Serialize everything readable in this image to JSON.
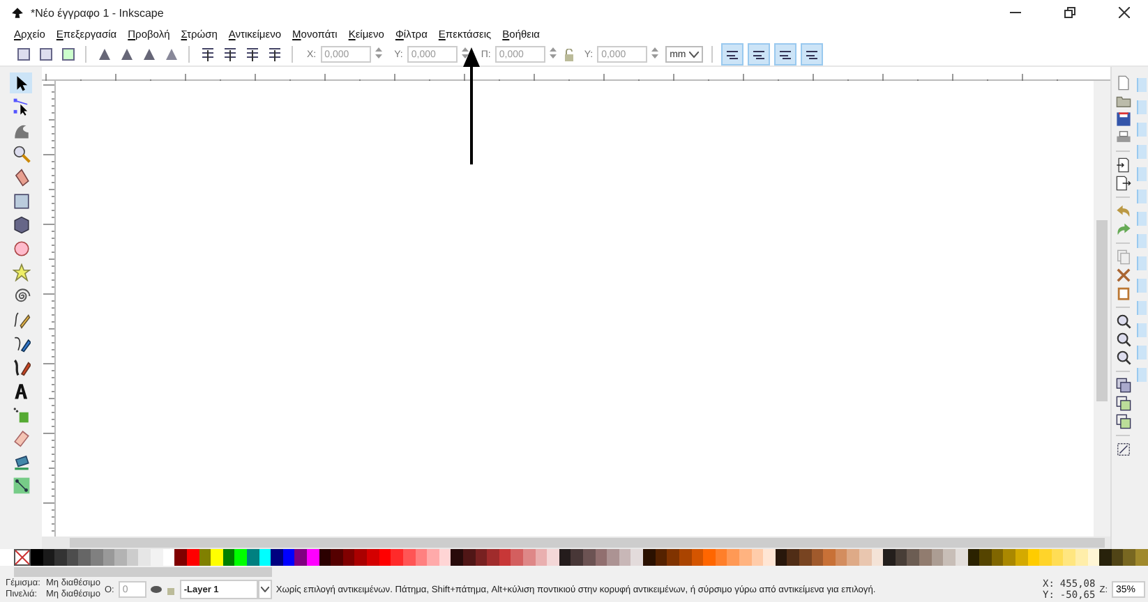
{
  "window": {
    "title": "*Νέο έγγραφο 1 - Inkscape"
  },
  "menu": [
    "Αρχείο",
    "Επεξεργασία",
    "Προβολή",
    "Στρώση",
    "Αντικείμενο",
    "Μονοπάτι",
    "Κείμενο",
    "Φίλτρα",
    "Επεκτάσεις",
    "Βοήθεια"
  ],
  "toolbar": {
    "fields": [
      {
        "label": "X:",
        "value": "0,000"
      },
      {
        "label": "Y:",
        "value": "0,000"
      },
      {
        "label": "Π:",
        "value": "0,000"
      },
      {
        "label": "Υ:",
        "value": "0,000"
      }
    ],
    "unit": "mm",
    "toggles": [
      {
        "on": true
      },
      {
        "on": true
      },
      {
        "on": true
      },
      {
        "on": true
      }
    ]
  },
  "tools": [
    {
      "kind": "selector",
      "selected": true
    },
    {
      "kind": "node",
      "selected": false
    },
    {
      "kind": "tweak",
      "selected": false
    },
    {
      "kind": "zoom",
      "selected": false
    },
    {
      "kind": "measure",
      "selected": false
    },
    {
      "kind": "rect",
      "selected": false
    },
    {
      "kind": "box3d",
      "selected": false
    },
    {
      "kind": "ellipse",
      "selected": false
    },
    {
      "kind": "star",
      "selected": false
    },
    {
      "kind": "spiral",
      "selected": false
    },
    {
      "kind": "pencil",
      "selected": false
    },
    {
      "kind": "pen",
      "selected": false
    },
    {
      "kind": "calligraphy",
      "selected": false
    },
    {
      "kind": "text",
      "selected": false
    },
    {
      "kind": "spray",
      "selected": false
    },
    {
      "kind": "eraser",
      "selected": false
    },
    {
      "kind": "bucket",
      "selected": false
    },
    {
      "kind": "connector",
      "selected": false
    }
  ],
  "commands": [
    {
      "kind": "new"
    },
    {
      "kind": "open"
    },
    {
      "kind": "save"
    },
    {
      "kind": "print"
    },
    {
      "kind": "separator"
    },
    {
      "kind": "import"
    },
    {
      "kind": "export"
    },
    {
      "kind": "separator"
    },
    {
      "kind": "undo"
    },
    {
      "kind": "redo"
    },
    {
      "kind": "separator"
    },
    {
      "kind": "copy"
    },
    {
      "kind": "cut"
    },
    {
      "kind": "paste"
    },
    {
      "kind": "separator"
    },
    {
      "kind": "zoom"
    },
    {
      "kind": "zoom"
    },
    {
      "kind": "zoom"
    },
    {
      "kind": "separator"
    },
    {
      "kind": "duplicate"
    },
    {
      "kind": "clone"
    },
    {
      "kind": "clone"
    },
    {
      "kind": "separator"
    },
    {
      "kind": "group"
    }
  ],
  "palette": [
    {
      "color": "#000000"
    },
    {
      "color": "#1a1a1a"
    },
    {
      "color": "#333333"
    },
    {
      "color": "#4d4d4d"
    },
    {
      "color": "#666666"
    },
    {
      "color": "#808080"
    },
    {
      "color": "#999999"
    },
    {
      "color": "#b3b3b3"
    },
    {
      "color": "#cccccc"
    },
    {
      "color": "#e6e6e6"
    },
    {
      "color": "#f2f2f2"
    },
    {
      "color": "#ffffff"
    },
    {
      "color": "#800000"
    },
    {
      "color": "#ff0000"
    },
    {
      "color": "#808000"
    },
    {
      "color": "#ffff00"
    },
    {
      "color": "#008000"
    },
    {
      "color": "#00ff00"
    },
    {
      "color": "#008080"
    },
    {
      "color": "#00ffff"
    },
    {
      "color": "#000080"
    },
    {
      "color": "#0000ff"
    },
    {
      "color": "#800080"
    },
    {
      "color": "#ff00ff"
    },
    {
      "color": "#2b0000"
    },
    {
      "color": "#550000"
    },
    {
      "color": "#800000"
    },
    {
      "color": "#aa0000"
    },
    {
      "color": "#d40000"
    },
    {
      "color": "#ff0000"
    },
    {
      "color": "#ff2a2a"
    },
    {
      "color": "#ff5555"
    },
    {
      "color": "#ff8080"
    },
    {
      "color": "#ffaaaa"
    },
    {
      "color": "#ffd5d5"
    },
    {
      "color": "#280b0b"
    },
    {
      "color": "#501616"
    },
    {
      "color": "#782121"
    },
    {
      "color": "#a02c2c"
    },
    {
      "color": "#c83737"
    },
    {
      "color": "#d35f5f"
    },
    {
      "color": "#de8787"
    },
    {
      "color": "#e9afaf"
    },
    {
      "color": "#f4d7d7"
    },
    {
      "color": "#241c1c"
    },
    {
      "color": "#483737"
    },
    {
      "color": "#6c5353"
    },
    {
      "color": "#916f6f"
    },
    {
      "color": "#ac9393"
    },
    {
      "color": "#c8b7b7"
    },
    {
      "color": "#e3dbdb"
    },
    {
      "color": "#2b1100"
    },
    {
      "color": "#552200"
    },
    {
      "color": "#803300"
    },
    {
      "color": "#aa4400"
    },
    {
      "color": "#d45500"
    },
    {
      "color": "#ff6600"
    },
    {
      "color": "#ff7f2a"
    },
    {
      "color": "#ff9955"
    },
    {
      "color": "#ffb380"
    },
    {
      "color": "#ffccaa"
    },
    {
      "color": "#ffe6d5"
    },
    {
      "color": "#28170b"
    },
    {
      "color": "#502d16"
    },
    {
      "color": "#784421"
    },
    {
      "color": "#a05a2c"
    },
    {
      "color": "#c87137"
    },
    {
      "color": "#d38d5f"
    },
    {
      "color": "#deaa87"
    },
    {
      "color": "#e9c6af"
    },
    {
      "color": "#f4e3d7"
    },
    {
      "color": "#241f1c"
    },
    {
      "color": "#483e37"
    },
    {
      "color": "#6c5d53"
    },
    {
      "color": "#917c6f"
    },
    {
      "color": "#ac9d93"
    },
    {
      "color": "#c8beb7"
    },
    {
      "color": "#e3dedb"
    },
    {
      "color": "#2b2200"
    },
    {
      "color": "#554400"
    },
    {
      "color": "#806600"
    },
    {
      "color": "#aa8800"
    },
    {
      "color": "#d4aa00"
    },
    {
      "color": "#ffcc00"
    },
    {
      "color": "#ffd42a"
    },
    {
      "color": "#ffdd55"
    },
    {
      "color": "#ffe680"
    },
    {
      "color": "#ffeeaa"
    },
    {
      "color": "#fff6d5"
    },
    {
      "color": "#28220b"
    },
    {
      "color": "#504416"
    },
    {
      "color": "#786721"
    },
    {
      "color": "#a0892c"
    }
  ],
  "status": {
    "fill_label": "Γέμισμα:",
    "fill_value": "Μη διαθέσιμο",
    "stroke_label": "Πινελιά:",
    "stroke_value": "Μη διαθέσιμο",
    "opacity_label": "O:",
    "opacity_value": "0",
    "layer": "-Layer 1",
    "message": "Χωρίς επιλογή αντικειμένων. Πάτημα, Shift+πάτημα, Alt+κύλιση ποντικιού στην κορυφή αντικειμένων, ή σύρσιμο γύρω από αντικείμενα για επιλογή.",
    "x_label": "X:",
    "x_value": "455,08",
    "y_label": "Y:",
    "y_value": "-50,65",
    "zoom_label": "Z:",
    "zoom_value": "35%"
  }
}
